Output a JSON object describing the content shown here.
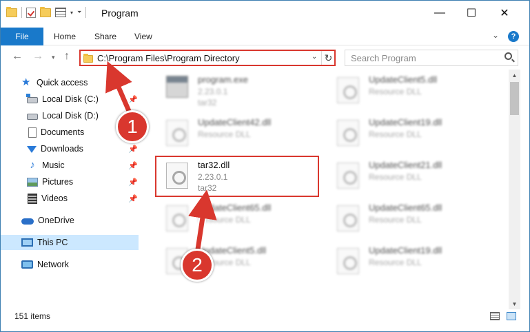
{
  "window": {
    "title": "Program"
  },
  "controls": {
    "minimize": "—",
    "maximize": "☐",
    "close": "✕"
  },
  "ribbon": {
    "file": "File",
    "home": "Home",
    "share": "Share",
    "view": "View",
    "help": "?"
  },
  "address": {
    "path": "C:\\Program Files\\Program Directory"
  },
  "search": {
    "placeholder": "Search Program"
  },
  "sidebar": {
    "items": [
      {
        "label": "Quick access"
      },
      {
        "label": "Local Disk (C:)"
      },
      {
        "label": "Local Disk (D:)"
      },
      {
        "label": "Documents"
      },
      {
        "label": "Downloads"
      },
      {
        "label": "Music"
      },
      {
        "label": "Pictures"
      },
      {
        "label": "Videos"
      },
      {
        "label": "OneDrive"
      },
      {
        "label": "This PC"
      },
      {
        "label": "Network"
      }
    ]
  },
  "files": [
    {
      "name": "program.exe",
      "line2": "2.23.0.1",
      "line3": "tar32"
    },
    {
      "name": "UpdateClient42.dll",
      "line2": "Resource DLL",
      "line3": ""
    },
    {
      "name": "tar32.dll",
      "line2": "2.23.0.1",
      "line3": "tar32"
    },
    {
      "name": "UpdateClient65.dll",
      "line2": "Resource DLL",
      "line3": ""
    },
    {
      "name": "UpdateClient5.dll",
      "line2": "Resource DLL",
      "line3": ""
    },
    {
      "name": "UpdateClient5.dll",
      "line2": "Resource DLL",
      "line3": ""
    },
    {
      "name": "UpdateClient19.dll",
      "line2": "Resource DLL",
      "line3": ""
    },
    {
      "name": "UpdateClient21.dll",
      "line2": "Resource DLL",
      "line3": ""
    },
    {
      "name": "UpdateClient65.dll",
      "line2": "Resource DLL",
      "line3": ""
    },
    {
      "name": "UpdateClient19.dll",
      "line2": "Resource DLL",
      "line3": ""
    }
  ],
  "status": {
    "count": "151 items"
  },
  "annotations": {
    "step1": "1",
    "step2": "2"
  },
  "colors": {
    "accent": "#1979ca",
    "highlight": "#d9372e",
    "selected": "#cce8ff"
  }
}
